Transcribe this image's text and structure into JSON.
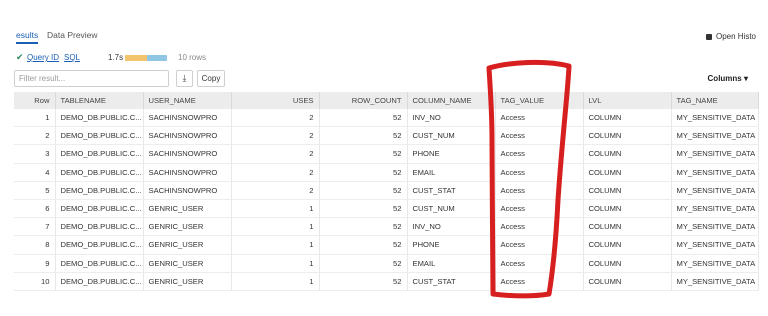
{
  "tabs": {
    "results": "esults",
    "data_preview": "Data Preview"
  },
  "open_history": "Open Histo",
  "meta": {
    "query_id": "Query ID",
    "sql": "SQL",
    "duration": "1.7s",
    "rows": "10 rows"
  },
  "filter": {
    "placeholder": "Filter result..."
  },
  "toolbar": {
    "download_icon": "download-icon",
    "copy_label": "Copy",
    "columns_label": "Columns ▾"
  },
  "colors": {
    "accent": "#1a5fb4",
    "success": "#2e8b57",
    "annotation": "#d81f1f",
    "header_bg": "#ececec"
  },
  "table": {
    "columns": [
      "Row",
      "TABLENAME",
      "USER_NAME",
      "USES",
      "ROW_COUNT",
      "COLUMN_NAME",
      "TAG_VALUE",
      "LVL",
      "TAG_NAME"
    ],
    "rows": [
      [
        "1",
        "DEMO_DB.PUBLIC.C...",
        "SACHINSNOWPRO",
        "2",
        "52",
        "INV_NO",
        "Access",
        "COLUMN",
        "MY_SENSITIVE_DATA"
      ],
      [
        "2",
        "DEMO_DB.PUBLIC.C...",
        "SACHINSNOWPRO",
        "2",
        "52",
        "CUST_NUM",
        "Access",
        "COLUMN",
        "MY_SENSITIVE_DATA"
      ],
      [
        "3",
        "DEMO_DB.PUBLIC.C...",
        "SACHINSNOWPRO",
        "2",
        "52",
        "PHONE",
        "Access",
        "COLUMN",
        "MY_SENSITIVE_DATA"
      ],
      [
        "4",
        "DEMO_DB.PUBLIC.C...",
        "SACHINSNOWPRO",
        "2",
        "52",
        "EMAIL",
        "Access",
        "COLUMN",
        "MY_SENSITIVE_DATA"
      ],
      [
        "5",
        "DEMO_DB.PUBLIC.C...",
        "SACHINSNOWPRO",
        "2",
        "52",
        "CUST_STAT",
        "Access",
        "COLUMN",
        "MY_SENSITIVE_DATA"
      ],
      [
        "6",
        "DEMO_DB.PUBLIC.C...",
        "GENRIC_USER",
        "1",
        "52",
        "CUST_NUM",
        "Access",
        "COLUMN",
        "MY_SENSITIVE_DATA"
      ],
      [
        "7",
        "DEMO_DB.PUBLIC.C...",
        "GENRIC_USER",
        "1",
        "52",
        "INV_NO",
        "Access",
        "COLUMN",
        "MY_SENSITIVE_DATA"
      ],
      [
        "8",
        "DEMO_DB.PUBLIC.C...",
        "GENRIC_USER",
        "1",
        "52",
        "PHONE",
        "Access",
        "COLUMN",
        "MY_SENSITIVE_DATA"
      ],
      [
        "9",
        "DEMO_DB.PUBLIC.C...",
        "GENRIC_USER",
        "1",
        "52",
        "EMAIL",
        "Access",
        "COLUMN",
        "MY_SENSITIVE_DATA"
      ],
      [
        "10",
        "DEMO_DB.PUBLIC.C...",
        "GENRIC_USER",
        "1",
        "52",
        "CUST_STAT",
        "Access",
        "COLUMN",
        "MY_SENSITIVE_DATA"
      ]
    ]
  }
}
